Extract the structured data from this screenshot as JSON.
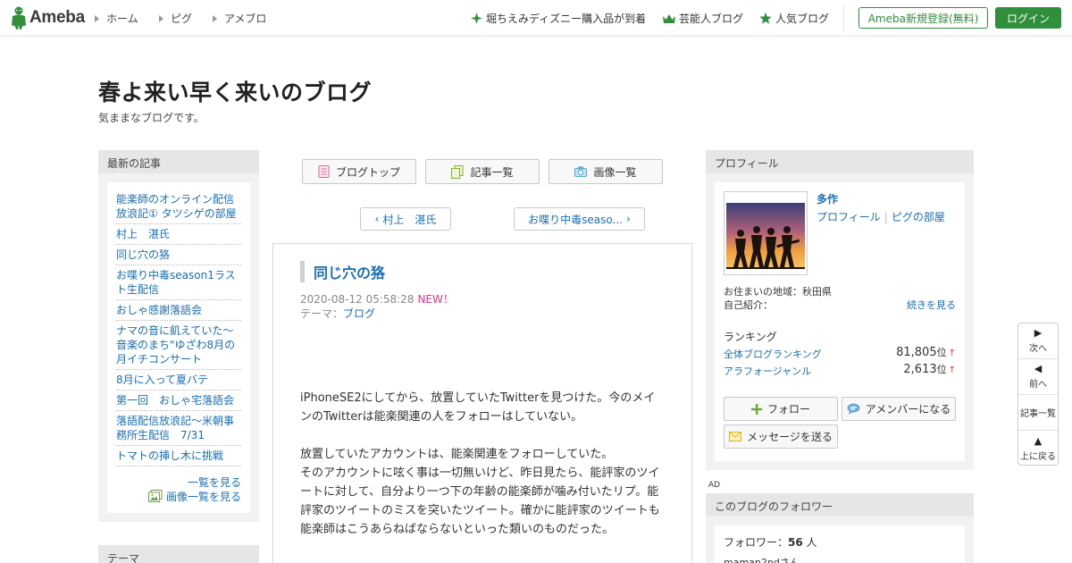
{
  "header": {
    "logo_text": "Ameba",
    "nav": [
      "ホーム",
      "ピグ",
      "アメブロ"
    ],
    "promos": [
      {
        "label": "堀ちえみディズニー購入品が到着",
        "icon": "sparkle-icon"
      },
      {
        "label": "芸能人ブログ",
        "icon": "crown-icon"
      },
      {
        "label": "人気ブログ",
        "icon": "star-icon"
      }
    ],
    "register_label": "Ameba新規登録(無料)",
    "login_label": "ログイン"
  },
  "blog": {
    "title": "春よ来い早く来いのブログ",
    "description": "気ままなブログです。"
  },
  "left": {
    "recent_head": "最新の記事",
    "recent_items": [
      "能楽師のオンライン配信放浪記① タツシゲの部屋",
      "村上　湛氏",
      "同じ穴の狢",
      "お喋り中毒season1ラスト生配信",
      "おしゃ感謝落語会",
      "ナマの音に飢えていた〜音楽のまち\"ゆざわ8月の月イチコンサート",
      "8月に入って夏バテ",
      "第一回　おしゃ宅落語会",
      "落語配信放浪記〜米朝事務所生配信　7/31",
      "トマトの挿し木に挑戦"
    ],
    "more_list": "一覧を見る",
    "more_images": "画像一覧を見る",
    "theme_head": "テーマ"
  },
  "main": {
    "tabs": [
      "ブログトップ",
      "記事一覧",
      "画像一覧"
    ],
    "prev_label": "村上　湛氏",
    "next_label": "お喋り中毒seaso...",
    "article": {
      "title": "同じ穴の狢",
      "datetime": "2020-08-12 05:58:28",
      "new_badge": "NEW！",
      "theme_label": "テーマ：",
      "theme_value": "ブログ",
      "paragraphs": [
        "iPhoneSE2にしてから、放置していたTwitterを見つけた。今のメインのTwitterは能楽関連の人をフォローはしていない。",
        "放置していたアカウントは、能楽関連をフォローしていた。\nそのアカウントに呟く事は一切無いけど、昨日見たら、能評家のツイートに対して、自分より一つ下の年齢の能楽師が噛み付いたリプ。能評家のツイートのミスを突いたツイート。確かに能評家のツイートも能楽師はこうあらねばならないといった類いのものだった。"
      ]
    }
  },
  "right": {
    "profile_head": "プロフィール",
    "name": "多作",
    "link_profile": "プロフィール",
    "link_pig": "ピグの部屋",
    "area": "お住まいの地域：秋田県",
    "intro": "自己紹介：",
    "more": "続きを見る",
    "ranking_head": "ランキング",
    "rankings": [
      {
        "name": "全体ブログランキング",
        "value": "81,805",
        "unit": "位",
        "trend": "↑"
      },
      {
        "name": "アラフォージャンル",
        "value": "2,613",
        "unit": "位",
        "trend": "↑"
      }
    ],
    "follow_label": "フォロー",
    "member_label": "アメンバーになる",
    "message_label": "メッセージを送る",
    "ad_label": "AD",
    "followers_head": "このブログのフォロワー",
    "followers_label": "フォロワー：",
    "followers_count": "56",
    "followers_unit": "人",
    "followers_first": "maman2ndさん"
  },
  "float_nav": {
    "next": "次へ",
    "prev": "前へ",
    "list": "記事一覧",
    "top": "上に戻る"
  },
  "colors": {
    "brand_green": "#2f8f3a",
    "link_blue": "#1a6fb7",
    "new_pink": "#e8358b"
  }
}
